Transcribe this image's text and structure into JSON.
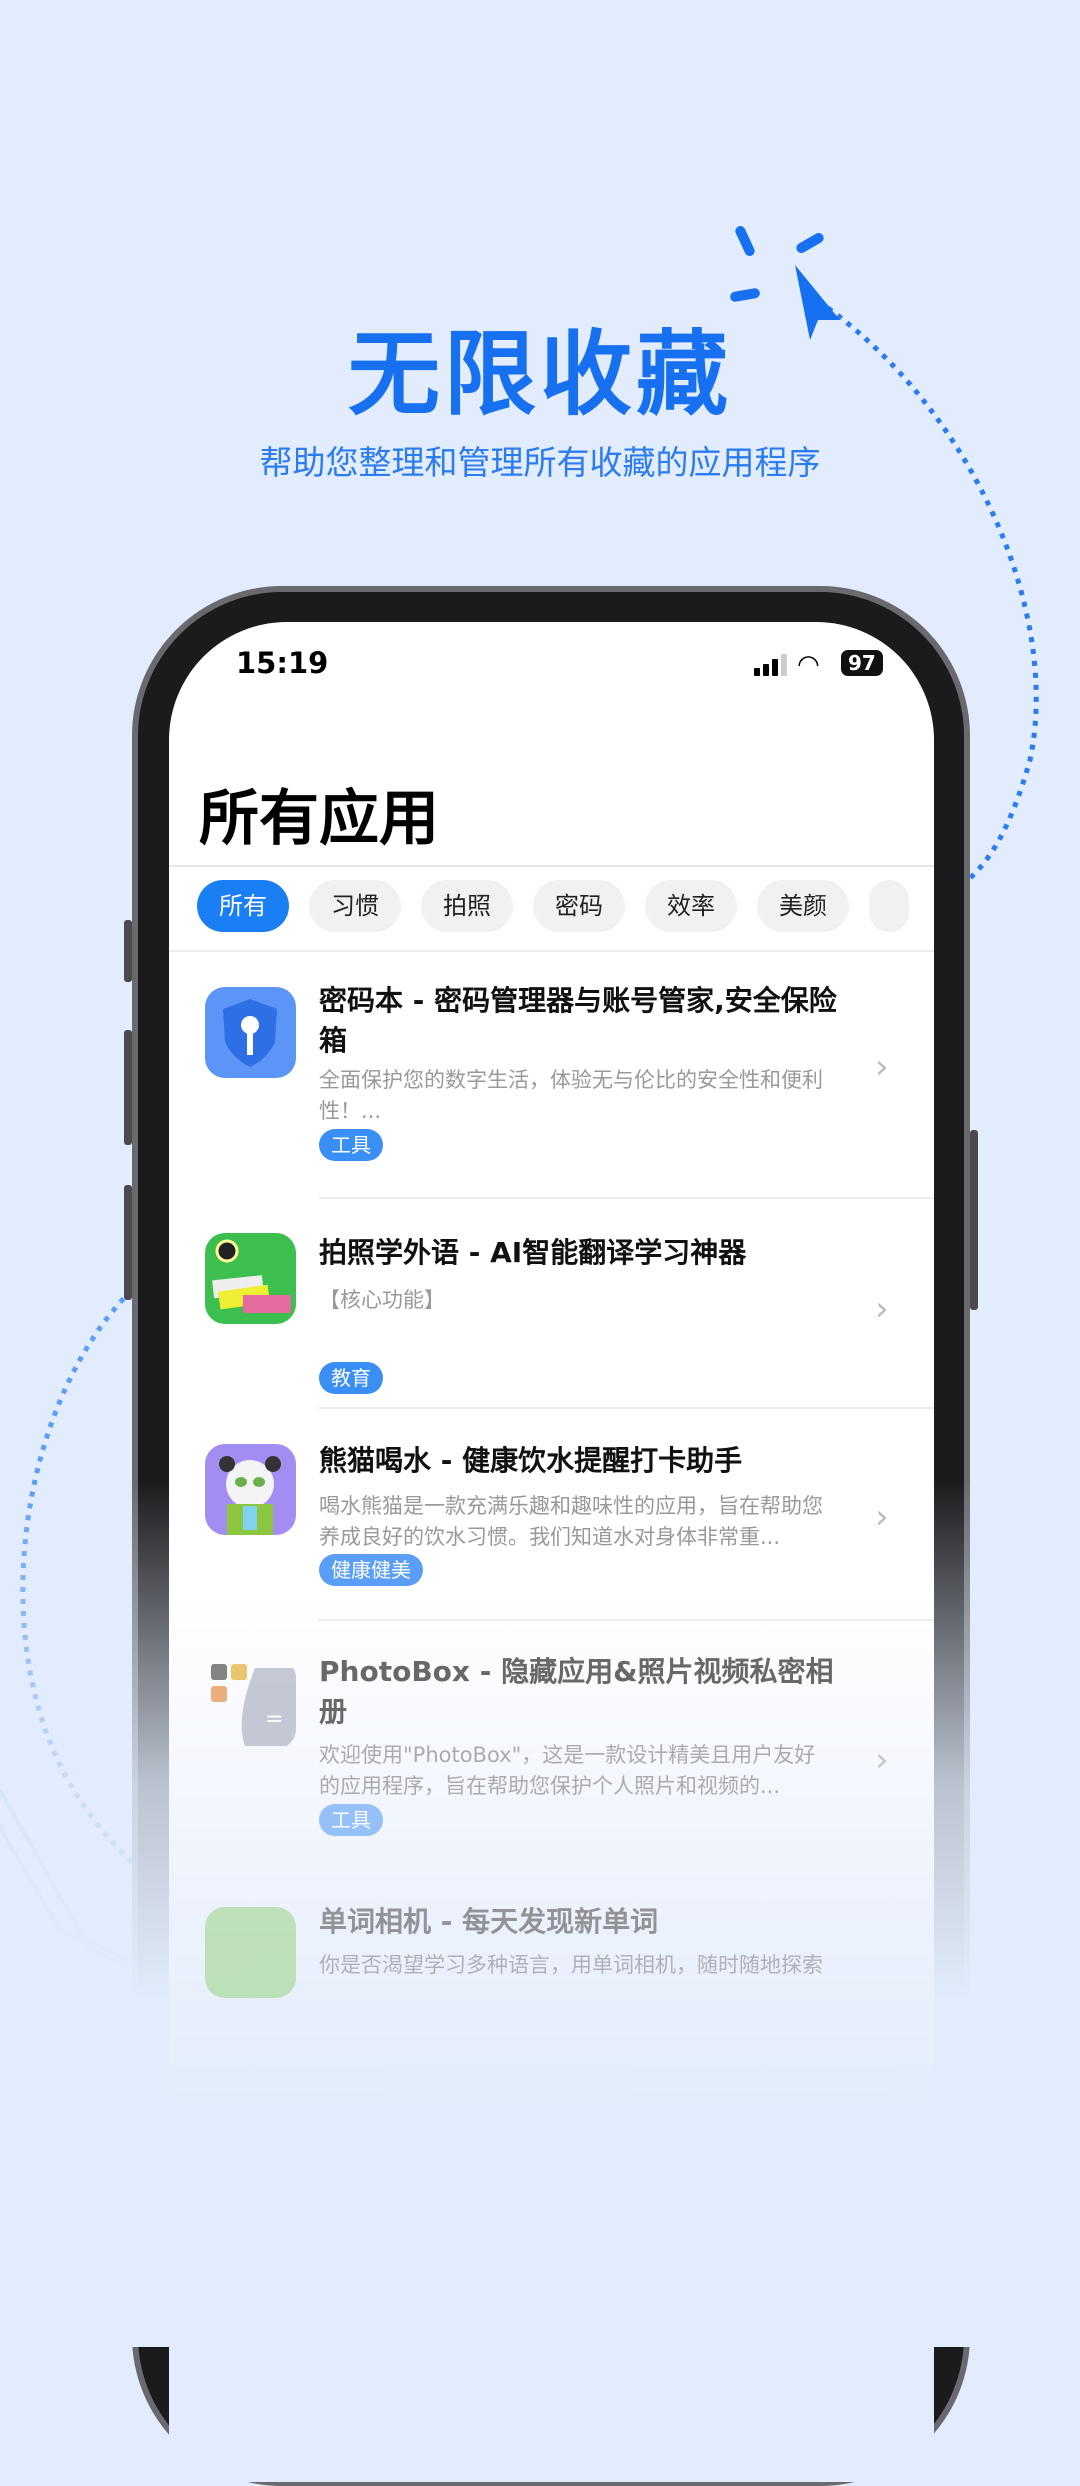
{
  "hero": {
    "title": "无限收藏",
    "subtitle": "帮助您整理和管理所有收藏的应用程序"
  },
  "status": {
    "time": "15:19",
    "battery": "97"
  },
  "page": {
    "title": "所有应用"
  },
  "chips": [
    {
      "label": "所有",
      "active": true
    },
    {
      "label": "习惯"
    },
    {
      "label": "拍照"
    },
    {
      "label": "密码"
    },
    {
      "label": "效率"
    },
    {
      "label": "美颜"
    }
  ],
  "apps": [
    {
      "title": "密码本 - 密码管理器与账号管家,安全保险箱",
      "desc": "全面保护您的数字生活，体验无与伦比的安全性和便利性！...",
      "tag": "工具"
    },
    {
      "title": "拍照学外语 - AI智能翻译学习神器",
      "desc": "【核心功能】",
      "tag": "教育"
    },
    {
      "title": "熊猫喝水 - 健康饮水提醒打卡助手",
      "desc": "喝水熊猫是一款充满乐趣和趣味性的应用，旨在帮助您养成良好的饮水习惯。我们知道水对身体非常重...",
      "tag": "健康健美"
    },
    {
      "title": "PhotoBox - 隐藏应用&照片视频私密相册",
      "desc": "欢迎使用\"PhotoBox\"，这是一款设计精美且用户友好的应用程序，旨在帮助您保护个人照片和视频的...",
      "tag": "工具"
    },
    {
      "title": "单词相机 - 每天发现新单词",
      "desc": "你是否渴望学习多种语言，用单词相机，随时随地探索"
    }
  ],
  "colors": {
    "accent": "#1a7ff5",
    "background": "#e3ecfc",
    "title": "#1670f0"
  }
}
